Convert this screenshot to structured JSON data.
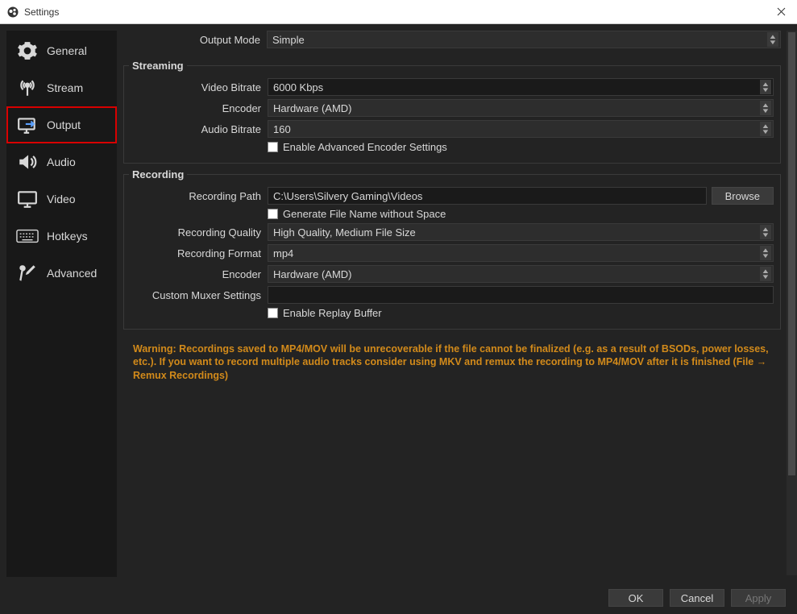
{
  "window": {
    "title": "Settings"
  },
  "sidebar": {
    "items": [
      {
        "label": "General"
      },
      {
        "label": "Stream"
      },
      {
        "label": "Output"
      },
      {
        "label": "Audio"
      },
      {
        "label": "Video"
      },
      {
        "label": "Hotkeys"
      },
      {
        "label": "Advanced"
      }
    ]
  },
  "output": {
    "mode_label": "Output Mode",
    "mode_value": "Simple"
  },
  "streaming": {
    "legend": "Streaming",
    "video_bitrate_label": "Video Bitrate",
    "video_bitrate_value": "6000 Kbps",
    "encoder_label": "Encoder",
    "encoder_value": "Hardware (AMD)",
    "audio_bitrate_label": "Audio Bitrate",
    "audio_bitrate_value": "160",
    "enable_advanced_label": "Enable Advanced Encoder Settings"
  },
  "recording": {
    "legend": "Recording",
    "path_label": "Recording Path",
    "path_value": "C:\\Users\\Silvery Gaming\\Videos",
    "browse_label": "Browse",
    "gen_filename_label": "Generate File Name without Space",
    "quality_label": "Recording Quality",
    "quality_value": "High Quality, Medium File Size",
    "format_label": "Recording Format",
    "format_value": "mp4",
    "encoder_label": "Encoder",
    "encoder_value": "Hardware (AMD)",
    "muxer_label": "Custom Muxer Settings",
    "muxer_value": "",
    "replay_buffer_label": "Enable Replay Buffer"
  },
  "warning": "Warning: Recordings saved to MP4/MOV will be unrecoverable if the file cannot be finalized (e.g. as a result of BSODs, power losses, etc.). If you want to record multiple audio tracks consider using MKV and remux the recording to MP4/MOV after it is finished (File → Remux Recordings)",
  "footer": {
    "ok": "OK",
    "cancel": "Cancel",
    "apply": "Apply"
  }
}
